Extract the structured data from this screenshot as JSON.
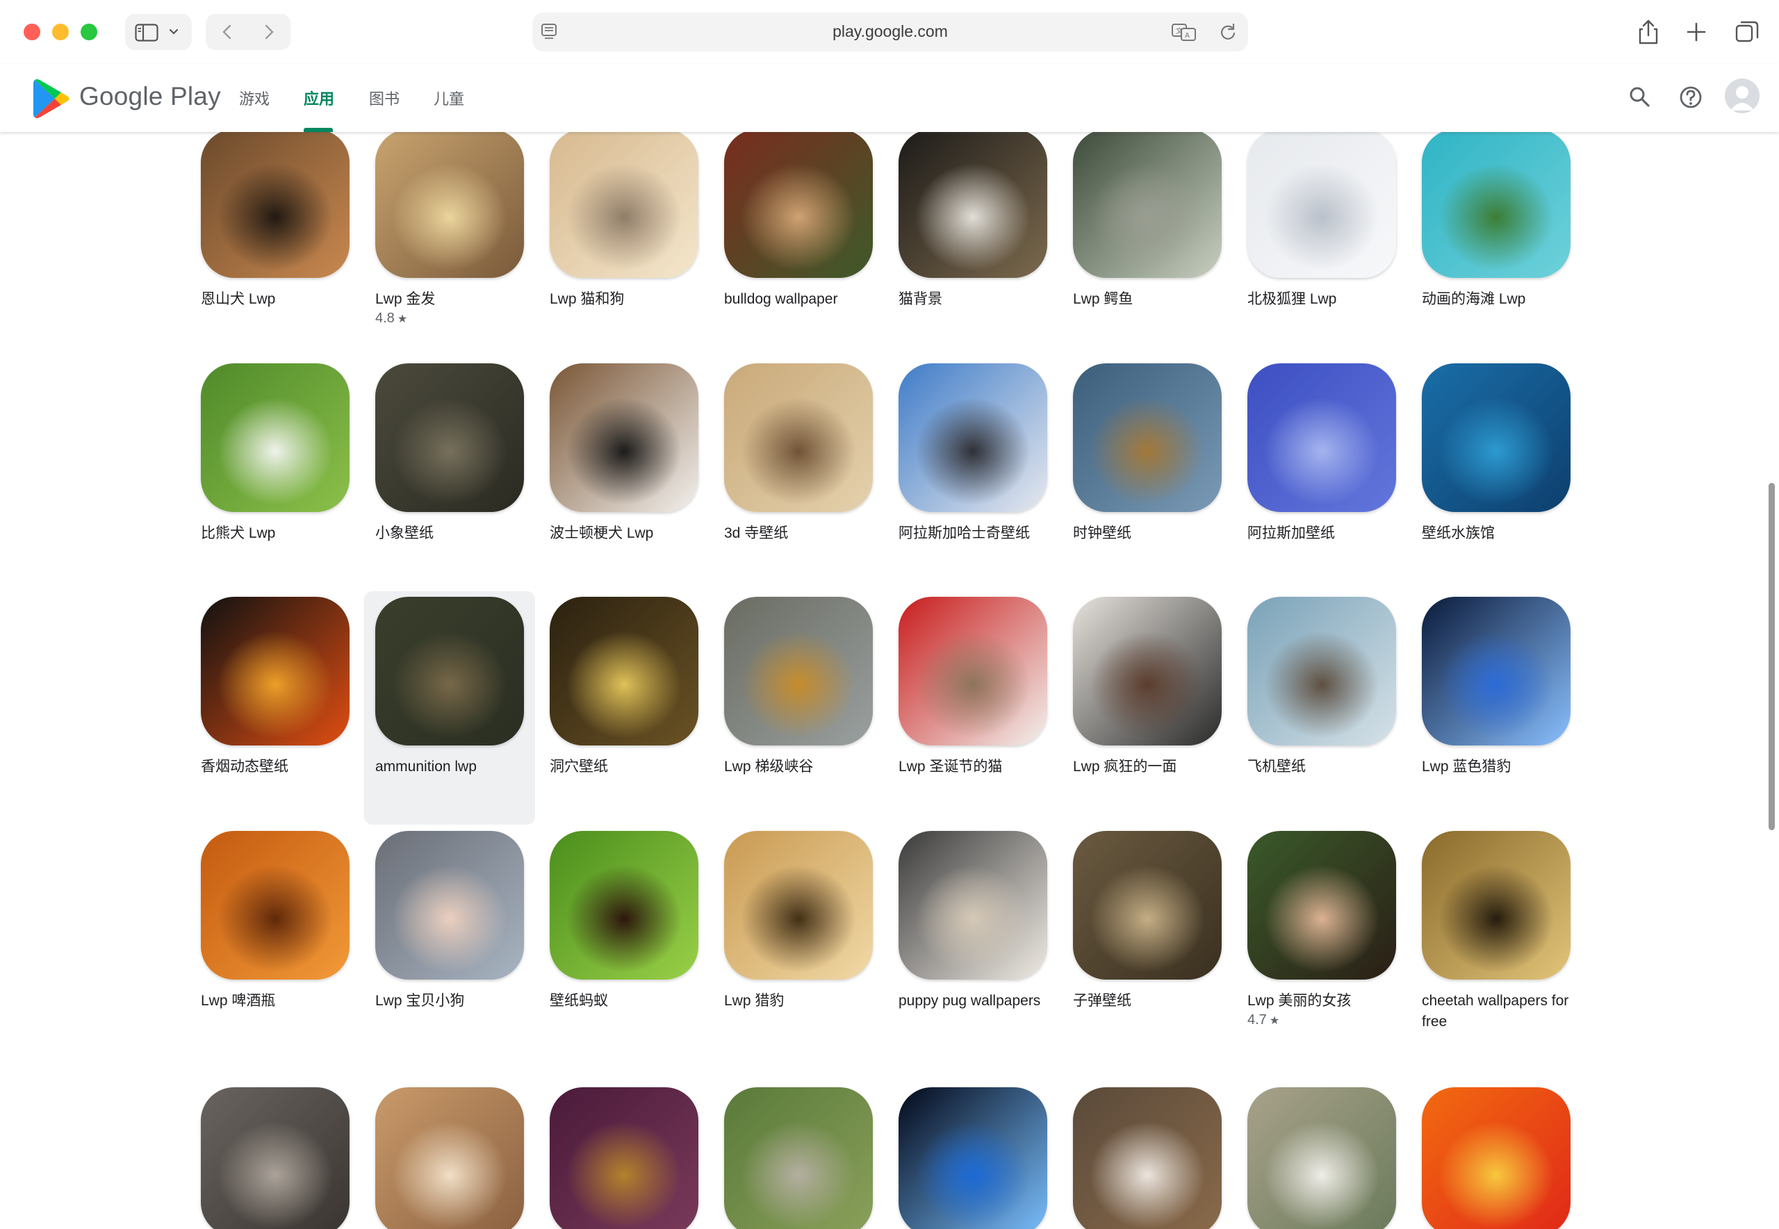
{
  "browser": {
    "url": "play.google.com"
  },
  "store": {
    "brand": "Google Play",
    "nav_tabs": [
      {
        "label": "游戏",
        "active": false
      },
      {
        "label": "应用",
        "active": true
      },
      {
        "label": "图书",
        "active": false
      },
      {
        "label": "儿童",
        "active": false
      }
    ],
    "accent_color": "#01875f"
  },
  "apps": [
    {
      "name": "恩山犬 Lwp",
      "icon": "bernese-dog-icon",
      "colors": [
        "#6b4a2c",
        "#1b1510",
        "#c9884f"
      ]
    },
    {
      "name": "Lwp 金发",
      "rating": "4.8",
      "icon": "blonde-woman-icon",
      "colors": [
        "#c9a470",
        "#efd9a0",
        "#7a5a3a"
      ]
    },
    {
      "name": "Lwp 猫和狗",
      "icon": "puppy-kitten-icon",
      "colors": [
        "#d7b98f",
        "#8c7a66",
        "#f4e6cc"
      ]
    },
    {
      "name": "bulldog wallpaper",
      "icon": "bulldog-icon",
      "colors": [
        "#7a2c1e",
        "#d6a676",
        "#3e5a2a"
      ]
    },
    {
      "name": "猫背景",
      "icon": "black-white-cat-icon",
      "colors": [
        "#1c1a18",
        "#e9e6e0",
        "#7c6a4e"
      ]
    },
    {
      "name": "Lwp 鳄鱼",
      "icon": "crocodile-icon",
      "colors": [
        "#3c4a3a",
        "#9a9e92",
        "#c8d0c0"
      ]
    },
    {
      "name": "北极狐狸 Lwp",
      "icon": "arctic-fox-icon",
      "colors": [
        "#e6e9ed",
        "#b7bec8",
        "#f7f8fa"
      ]
    },
    {
      "name": "动画的海滩 Lwp",
      "icon": "beach-boat-icon",
      "colors": [
        "#2fb4c5",
        "#3b7a2c",
        "#6ed1da"
      ]
    },
    {
      "name": "比熊犬 Lwp",
      "icon": "bichon-dog-icon",
      "colors": [
        "#4f8a2a",
        "#f6f6f4",
        "#8cc04a"
      ]
    },
    {
      "name": "小象壁纸",
      "icon": "elephant-icon",
      "colors": [
        "#4b4a3c",
        "#7a735e",
        "#2b2a22"
      ]
    },
    {
      "name": "波士顿梗犬 Lwp",
      "icon": "boston-terrier-icon",
      "colors": [
        "#7a5636",
        "#141414",
        "#f3f1ee"
      ]
    },
    {
      "name": "3d 寺壁纸",
      "icon": "temple-icon",
      "colors": [
        "#c9a979",
        "#6b4e32",
        "#e4d1ad"
      ]
    },
    {
      "name": "阿拉斯加哈士奇壁纸",
      "icon": "husky-icon",
      "colors": [
        "#3f7cc8",
        "#2a2a2e",
        "#e7e9ee"
      ]
    },
    {
      "name": "时钟壁纸",
      "icon": "clock-tree-icon",
      "colors": [
        "#3c5e7a",
        "#a67834",
        "#7a9ab6"
      ]
    },
    {
      "name": "阿拉斯加壁纸",
      "icon": "snow-landscape-icon",
      "colors": [
        "#3d4fc2",
        "#a9b8f0",
        "#6276dc"
      ]
    },
    {
      "name": "壁纸水族馆",
      "icon": "aquarium-icon",
      "colors": [
        "#1a6ea8",
        "#2e9ed4",
        "#0d3f6e"
      ]
    },
    {
      "name": "香烟动态壁纸",
      "icon": "cigarette-icon",
      "colors": [
        "#111111",
        "#f2a52a",
        "#e04e12"
      ]
    },
    {
      "name": "ammunition lwp",
      "icon": "ammunition-icon",
      "colors": [
        "#3a3f2c",
        "#7b6a4a",
        "#2a2e22"
      ]
    },
    {
      "name": "洞穴壁纸",
      "icon": "cave-icon",
      "colors": [
        "#2b2110",
        "#e7c85b",
        "#6a5224"
      ]
    },
    {
      "name": "Lwp 梯级峡谷",
      "icon": "canyon-icon",
      "colors": [
        "#6a6c62",
        "#c98d28",
        "#9aa0a0"
      ]
    },
    {
      "name": "Lwp 圣诞节的猫",
      "icon": "christmas-cat-icon",
      "colors": [
        "#c81c1c",
        "#8a7258",
        "#f2f2ee"
      ]
    },
    {
      "name": "Lwp 疯狂的一面",
      "icon": "crazy-face-icon",
      "colors": [
        "#e6e2dc",
        "#5a3a2a",
        "#2a2a2a"
      ]
    },
    {
      "name": "飞机壁纸",
      "icon": "bomber-plane-icon",
      "colors": [
        "#7aa2b8",
        "#5a4a3a",
        "#d6e2e8"
      ]
    },
    {
      "name": "Lwp 蓝色猎豹",
      "icon": "blue-leopard-icon",
      "colors": [
        "#0a1a3a",
        "#2a6ad8",
        "#8ac0ff"
      ]
    },
    {
      "name": "Lwp 啤酒瓶",
      "icon": "beer-bottle-icon",
      "colors": [
        "#c45a10",
        "#5a2408",
        "#f29a38"
      ]
    },
    {
      "name": "Lwp 宝贝小狗",
      "icon": "baby-puppy-icon",
      "colors": [
        "#6a6e76",
        "#f0d2c0",
        "#a8b4c2"
      ]
    },
    {
      "name": "壁纸蚂蚁",
      "icon": "ant-icon",
      "colors": [
        "#4a8e1c",
        "#2a0e0a",
        "#9ad048"
      ]
    },
    {
      "name": "Lwp 猎豹",
      "icon": "cheetah-icon",
      "colors": [
        "#c99a52",
        "#3a2810",
        "#f1d9a6"
      ]
    },
    {
      "name": "puppy pug wallpapers",
      "icon": "pug-icon",
      "colors": [
        "#3a3a3a",
        "#d8cbb8",
        "#f0ebe4"
      ]
    },
    {
      "name": "子弹壁纸",
      "icon": "bullets-icon",
      "colors": [
        "#6a5a40",
        "#cbb48a",
        "#3a3020"
      ]
    },
    {
      "name": "Lwp 美丽的女孩",
      "rating": "4.7",
      "icon": "beautiful-girl-icon",
      "colors": [
        "#3a5a2a",
        "#e4b898",
        "#2a1e16"
      ]
    },
    {
      "name": "cheetah wallpapers for free",
      "icon": "jaguar-icon",
      "colors": [
        "#8a6a2a",
        "#1e160a",
        "#e2c47a"
      ]
    },
    {
      "name": "",
      "icon": "sleeping-cat-icon",
      "colors": [
        "#6a6460",
        "#b0a89e",
        "#3a3430"
      ]
    },
    {
      "name": "",
      "icon": "bunny-icon",
      "colors": [
        "#c99a6a",
        "#f4e4cc",
        "#8a6040"
      ]
    },
    {
      "name": "",
      "icon": "owl-icon",
      "colors": [
        "#4a1a3a",
        "#b8862a",
        "#7a3a5a"
      ]
    },
    {
      "name": "",
      "icon": "kitten-icon",
      "colors": [
        "#5a7a3a",
        "#b8b0a4",
        "#8aa05a"
      ]
    },
    {
      "name": "",
      "icon": "blue-flame-icon",
      "colors": [
        "#020818",
        "#1a6ad8",
        "#7ac0ff"
      ]
    },
    {
      "name": "",
      "icon": "chihuahua-icon",
      "colors": [
        "#5a4a3a",
        "#f2ece6",
        "#8a6a4a"
      ]
    },
    {
      "name": "",
      "icon": "ballerina-icon",
      "colors": [
        "#a8a28a",
        "#f4f2ee",
        "#6a7a5a"
      ]
    },
    {
      "name": "",
      "icon": "light-streak-icon",
      "colors": [
        "#f26a10",
        "#f8d040",
        "#e02818"
      ]
    }
  ]
}
